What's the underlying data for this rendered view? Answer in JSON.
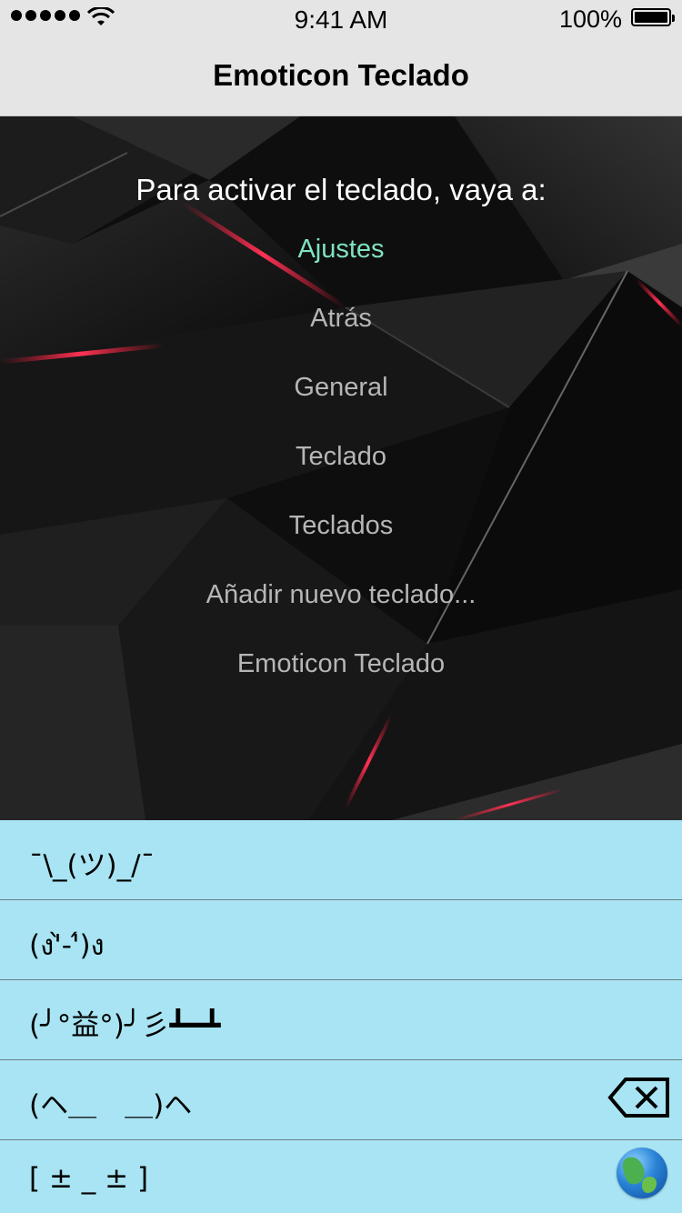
{
  "status_bar": {
    "time": "9:41 AM",
    "battery": "100%",
    "icons": [
      "signal-dots-icon",
      "wifi-icon",
      "battery-icon"
    ]
  },
  "nav": {
    "title": "Emoticon Teclado"
  },
  "hero": {
    "instruction": "Para activar el teclado, vaya a:",
    "steps": [
      "Ajustes",
      "Atrás",
      "General",
      "Teclado",
      "Teclados",
      "Añadir nuevo teclado...",
      "Emoticon Teclado"
    ],
    "active_color": "#7fe3c0"
  },
  "keyboard": {
    "rows": [
      "¯\\_(ツ)_/¯",
      "(ง'̀-'́)ง",
      "(╯°益°)╯彡┻━┻",
      "(ヘ＿　＿)ヘ",
      "[ ± _ ± ]"
    ],
    "background": "#a8e4f3",
    "icons": [
      "delete-key-icon",
      "globe-icon"
    ]
  }
}
